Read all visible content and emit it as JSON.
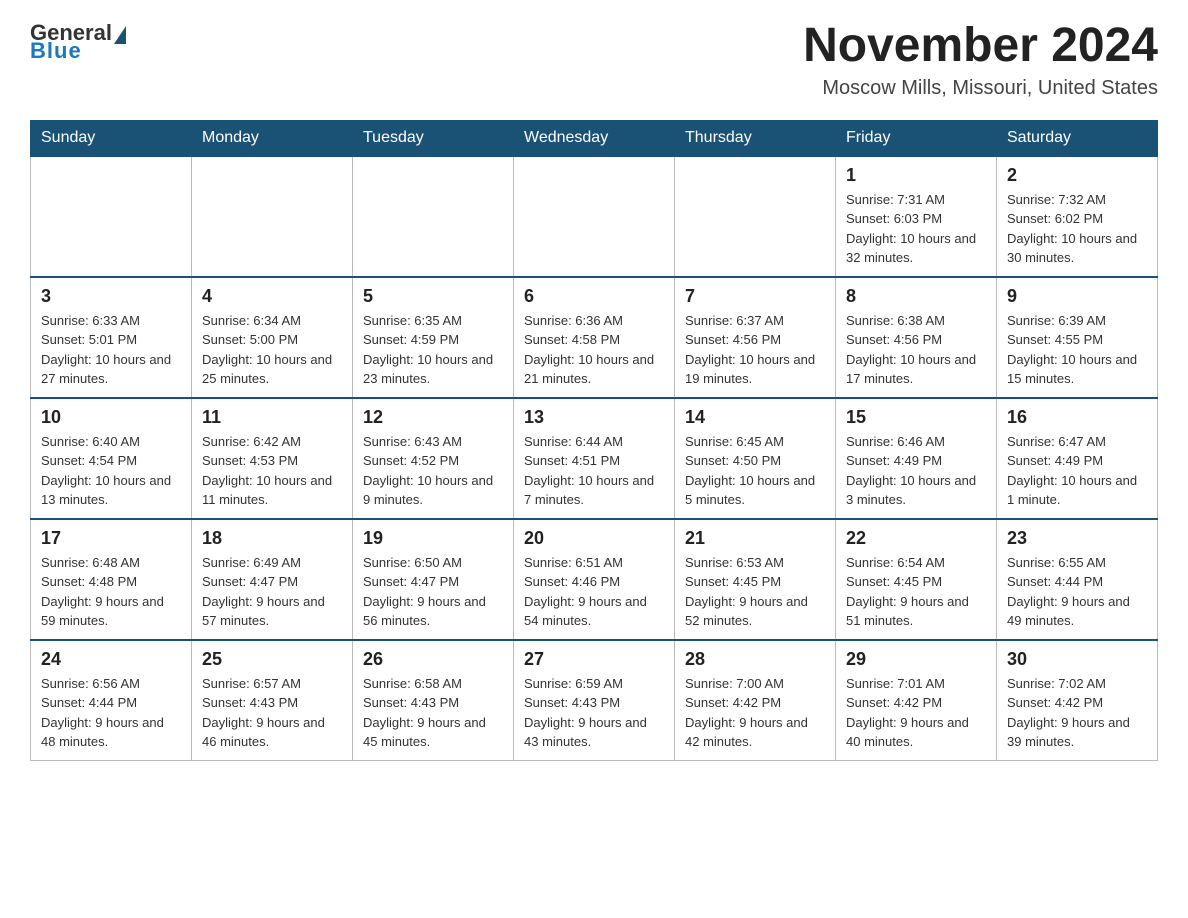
{
  "header": {
    "logo": {
      "general": "General",
      "blue": "Blue"
    },
    "title": "November 2024",
    "location": "Moscow Mills, Missouri, United States"
  },
  "weekdays": [
    "Sunday",
    "Monday",
    "Tuesday",
    "Wednesday",
    "Thursday",
    "Friday",
    "Saturday"
  ],
  "weeks": [
    [
      {
        "day": "",
        "info": ""
      },
      {
        "day": "",
        "info": ""
      },
      {
        "day": "",
        "info": ""
      },
      {
        "day": "",
        "info": ""
      },
      {
        "day": "",
        "info": ""
      },
      {
        "day": "1",
        "info": "Sunrise: 7:31 AM\nSunset: 6:03 PM\nDaylight: 10 hours and 32 minutes."
      },
      {
        "day": "2",
        "info": "Sunrise: 7:32 AM\nSunset: 6:02 PM\nDaylight: 10 hours and 30 minutes."
      }
    ],
    [
      {
        "day": "3",
        "info": "Sunrise: 6:33 AM\nSunset: 5:01 PM\nDaylight: 10 hours and 27 minutes."
      },
      {
        "day": "4",
        "info": "Sunrise: 6:34 AM\nSunset: 5:00 PM\nDaylight: 10 hours and 25 minutes."
      },
      {
        "day": "5",
        "info": "Sunrise: 6:35 AM\nSunset: 4:59 PM\nDaylight: 10 hours and 23 minutes."
      },
      {
        "day": "6",
        "info": "Sunrise: 6:36 AM\nSunset: 4:58 PM\nDaylight: 10 hours and 21 minutes."
      },
      {
        "day": "7",
        "info": "Sunrise: 6:37 AM\nSunset: 4:56 PM\nDaylight: 10 hours and 19 minutes."
      },
      {
        "day": "8",
        "info": "Sunrise: 6:38 AM\nSunset: 4:56 PM\nDaylight: 10 hours and 17 minutes."
      },
      {
        "day": "9",
        "info": "Sunrise: 6:39 AM\nSunset: 4:55 PM\nDaylight: 10 hours and 15 minutes."
      }
    ],
    [
      {
        "day": "10",
        "info": "Sunrise: 6:40 AM\nSunset: 4:54 PM\nDaylight: 10 hours and 13 minutes."
      },
      {
        "day": "11",
        "info": "Sunrise: 6:42 AM\nSunset: 4:53 PM\nDaylight: 10 hours and 11 minutes."
      },
      {
        "day": "12",
        "info": "Sunrise: 6:43 AM\nSunset: 4:52 PM\nDaylight: 10 hours and 9 minutes."
      },
      {
        "day": "13",
        "info": "Sunrise: 6:44 AM\nSunset: 4:51 PM\nDaylight: 10 hours and 7 minutes."
      },
      {
        "day": "14",
        "info": "Sunrise: 6:45 AM\nSunset: 4:50 PM\nDaylight: 10 hours and 5 minutes."
      },
      {
        "day": "15",
        "info": "Sunrise: 6:46 AM\nSunset: 4:49 PM\nDaylight: 10 hours and 3 minutes."
      },
      {
        "day": "16",
        "info": "Sunrise: 6:47 AM\nSunset: 4:49 PM\nDaylight: 10 hours and 1 minute."
      }
    ],
    [
      {
        "day": "17",
        "info": "Sunrise: 6:48 AM\nSunset: 4:48 PM\nDaylight: 9 hours and 59 minutes."
      },
      {
        "day": "18",
        "info": "Sunrise: 6:49 AM\nSunset: 4:47 PM\nDaylight: 9 hours and 57 minutes."
      },
      {
        "day": "19",
        "info": "Sunrise: 6:50 AM\nSunset: 4:47 PM\nDaylight: 9 hours and 56 minutes."
      },
      {
        "day": "20",
        "info": "Sunrise: 6:51 AM\nSunset: 4:46 PM\nDaylight: 9 hours and 54 minutes."
      },
      {
        "day": "21",
        "info": "Sunrise: 6:53 AM\nSunset: 4:45 PM\nDaylight: 9 hours and 52 minutes."
      },
      {
        "day": "22",
        "info": "Sunrise: 6:54 AM\nSunset: 4:45 PM\nDaylight: 9 hours and 51 minutes."
      },
      {
        "day": "23",
        "info": "Sunrise: 6:55 AM\nSunset: 4:44 PM\nDaylight: 9 hours and 49 minutes."
      }
    ],
    [
      {
        "day": "24",
        "info": "Sunrise: 6:56 AM\nSunset: 4:44 PM\nDaylight: 9 hours and 48 minutes."
      },
      {
        "day": "25",
        "info": "Sunrise: 6:57 AM\nSunset: 4:43 PM\nDaylight: 9 hours and 46 minutes."
      },
      {
        "day": "26",
        "info": "Sunrise: 6:58 AM\nSunset: 4:43 PM\nDaylight: 9 hours and 45 minutes."
      },
      {
        "day": "27",
        "info": "Sunrise: 6:59 AM\nSunset: 4:43 PM\nDaylight: 9 hours and 43 minutes."
      },
      {
        "day": "28",
        "info": "Sunrise: 7:00 AM\nSunset: 4:42 PM\nDaylight: 9 hours and 42 minutes."
      },
      {
        "day": "29",
        "info": "Sunrise: 7:01 AM\nSunset: 4:42 PM\nDaylight: 9 hours and 40 minutes."
      },
      {
        "day": "30",
        "info": "Sunrise: 7:02 AM\nSunset: 4:42 PM\nDaylight: 9 hours and 39 minutes."
      }
    ]
  ]
}
